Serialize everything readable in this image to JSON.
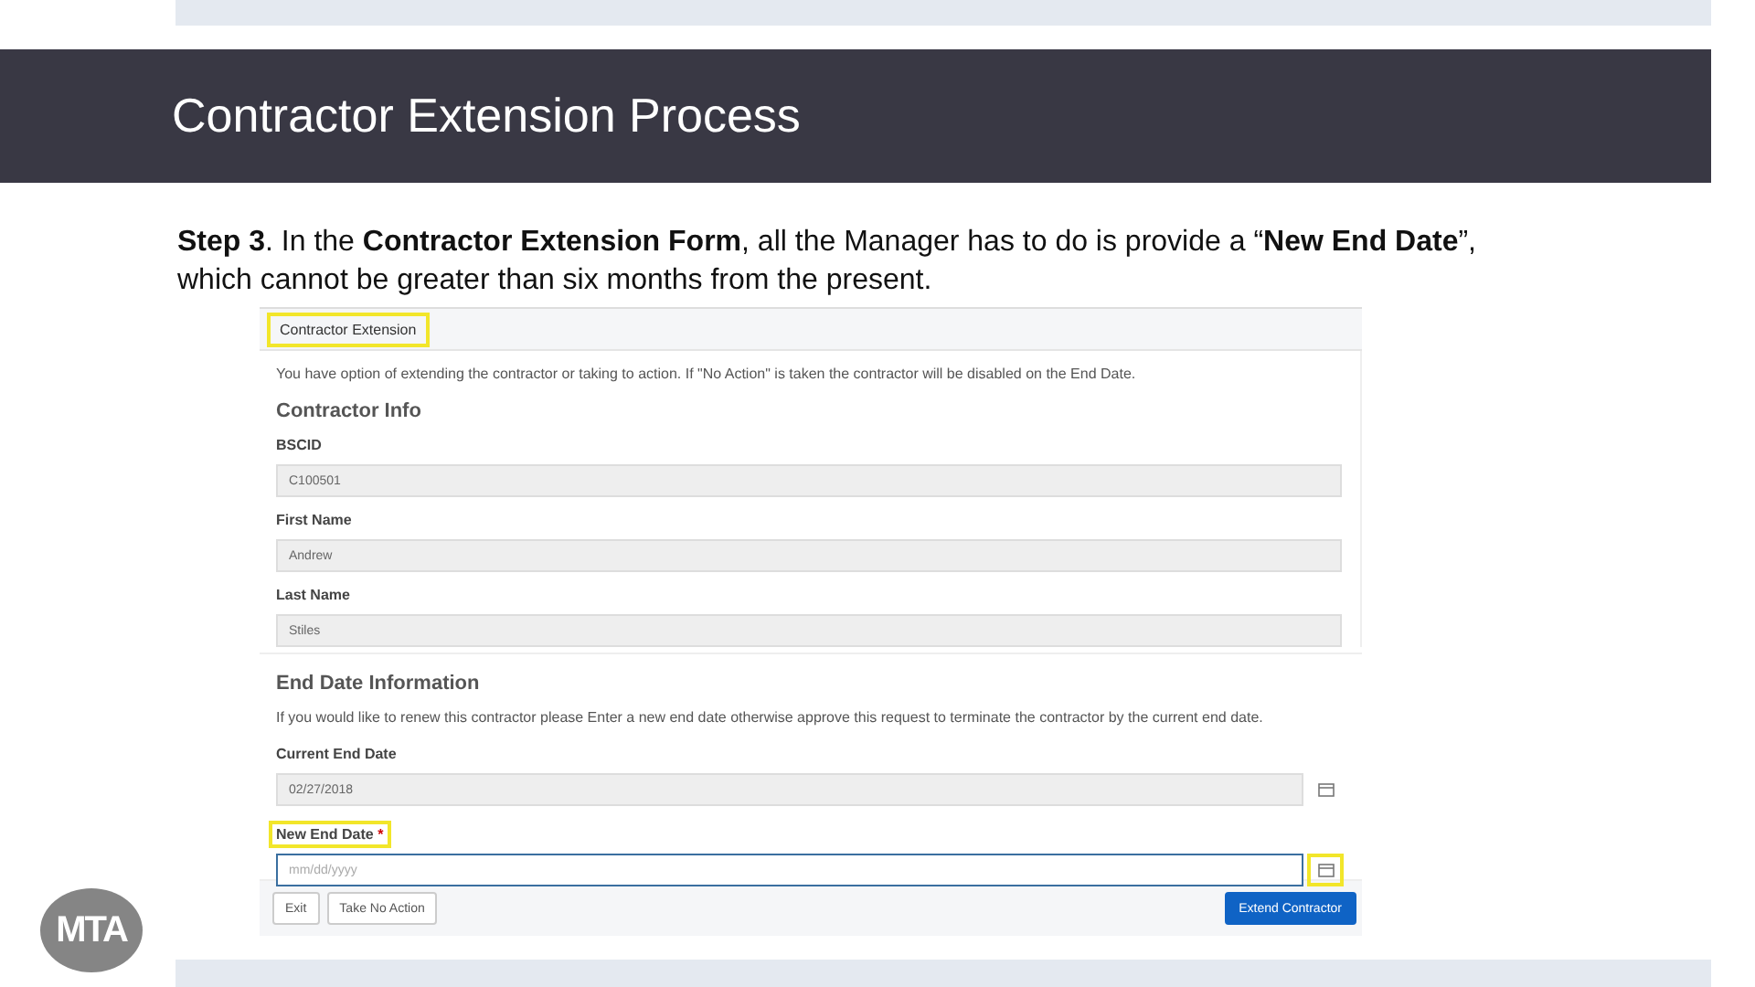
{
  "slide": {
    "title": "Contractor Extension Process",
    "caption": "**Step 3**. In the **Contractor Extension Form**, all the Manager has to do is provide a “**New End Date**”, which cannot be greater than six months from the present.",
    "logo": "MTA"
  },
  "form": {
    "title": "Contractor Extension",
    "title_highlighted": true,
    "sections": [
      {
        "heading": "Contractor Info",
        "intro": "You have option of extending the contractor or taking to action. If \"No Action\" is taken the contractor will be disabled on the End Date.",
        "fields": [
          {
            "label": "BSCID",
            "kind": "text",
            "value": "C100501",
            "disabled": true
          },
          {
            "label": "First Name",
            "kind": "text",
            "value": "Andrew",
            "disabled": true
          },
          {
            "label": "Last Name",
            "kind": "text",
            "value": "Stiles",
            "disabled": true
          }
        ]
      },
      {
        "heading": "End Date Information",
        "intro": "If you would like to renew this contractor please Enter a new end date otherwise approve this request to terminate the contractor by the current end date.",
        "fields": [
          {
            "label": "Current End Date",
            "kind": "date",
            "value": "02/27/2018",
            "disabled": true,
            "highlighted": false,
            "focused": false
          },
          {
            "label": "New End Date",
            "required_mark": "*",
            "kind": "date",
            "placeholder": "mm/dd/yyyy",
            "disabled": false,
            "highlighted": true,
            "focused": true
          }
        ]
      }
    ],
    "buttons": [
      {
        "label": "Exit",
        "kind": "default"
      },
      {
        "label": "Take No Action",
        "kind": "default"
      },
      {
        "label": "Extend Contractor",
        "kind": "primary"
      }
    ]
  }
}
